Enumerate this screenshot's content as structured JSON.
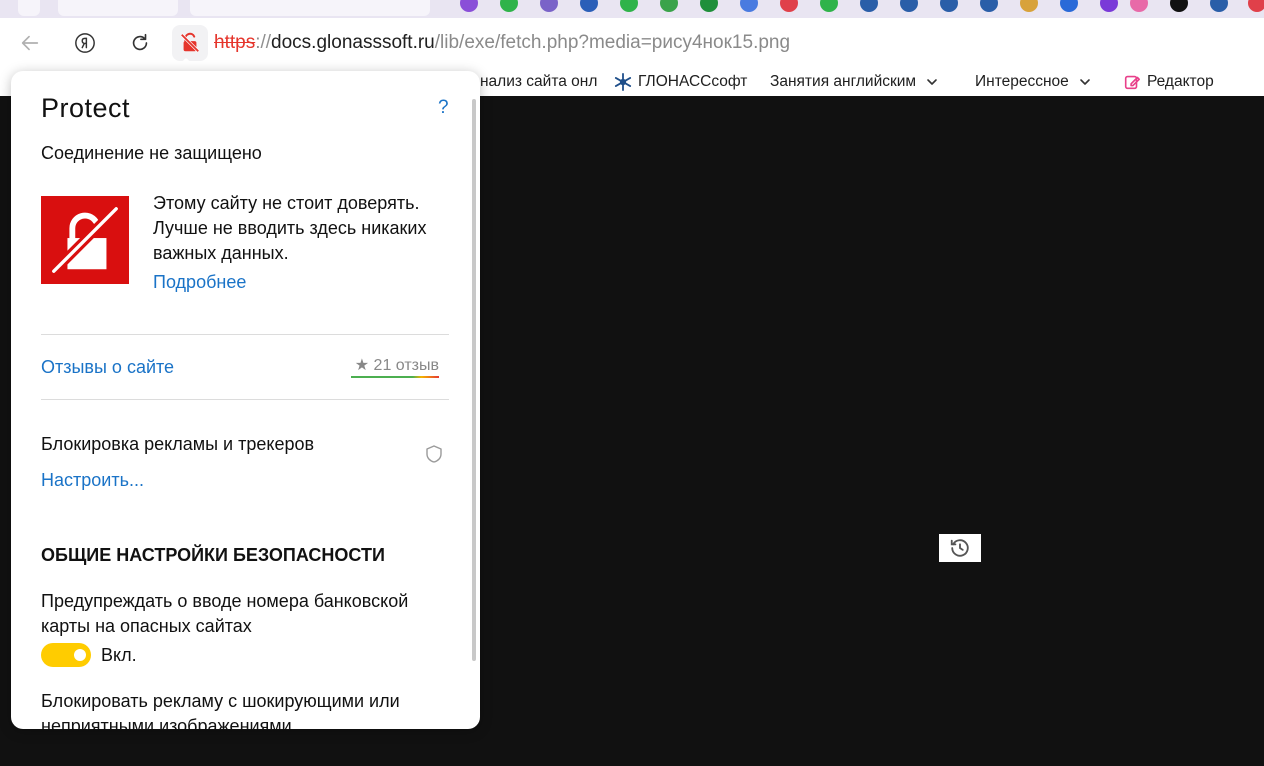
{
  "browser": {
    "url": {
      "scheme": "https",
      "separator": "://",
      "host": "docs.glonasssoft.ru",
      "path": "/lib/exe/fetch.php?media=рису4нок15.png"
    },
    "bookmarks": [
      {
        "label": "нализ сайта онл",
        "has_dropdown": false
      },
      {
        "label": "ГЛОНАССсофт",
        "has_dropdown": false
      },
      {
        "label": "Занятия английским",
        "has_dropdown": true
      },
      {
        "label": "Интерессное",
        "has_dropdown": true
      },
      {
        "label": "Редактор",
        "has_dropdown": false
      }
    ],
    "colors": {
      "insecure_red": "#e5352c",
      "link_blue": "#1a73c7",
      "toggle_yellow": "#ffcc00",
      "warn_red": "#d90f0f"
    }
  },
  "protect": {
    "title": "Protect",
    "help": "?",
    "connection_status": "Соединение не защищено",
    "warning_text": "Этому сайту не стоит доверять. Лучше не вводить здесь никаких важных данных.",
    "more_link": "Подробнее",
    "reviews_link": "Отзывы о сайте",
    "rating": "★ 21 отзыв",
    "tracker_block_label": "Блокировка рекламы и трекеров",
    "setup_link": "Настроить...",
    "section_title": "ОБЩИЕ НАСТРОЙКИ БЕЗОПАСНОСТИ",
    "bank_card_warning": "Предупреждать о вводе номера банковской карты на опасных сайтах",
    "toggle_label": "Вкл.",
    "toggle_on": true,
    "shock_ads_label": "Блокировать рекламу с шокирующими или неприятными изображениями"
  }
}
